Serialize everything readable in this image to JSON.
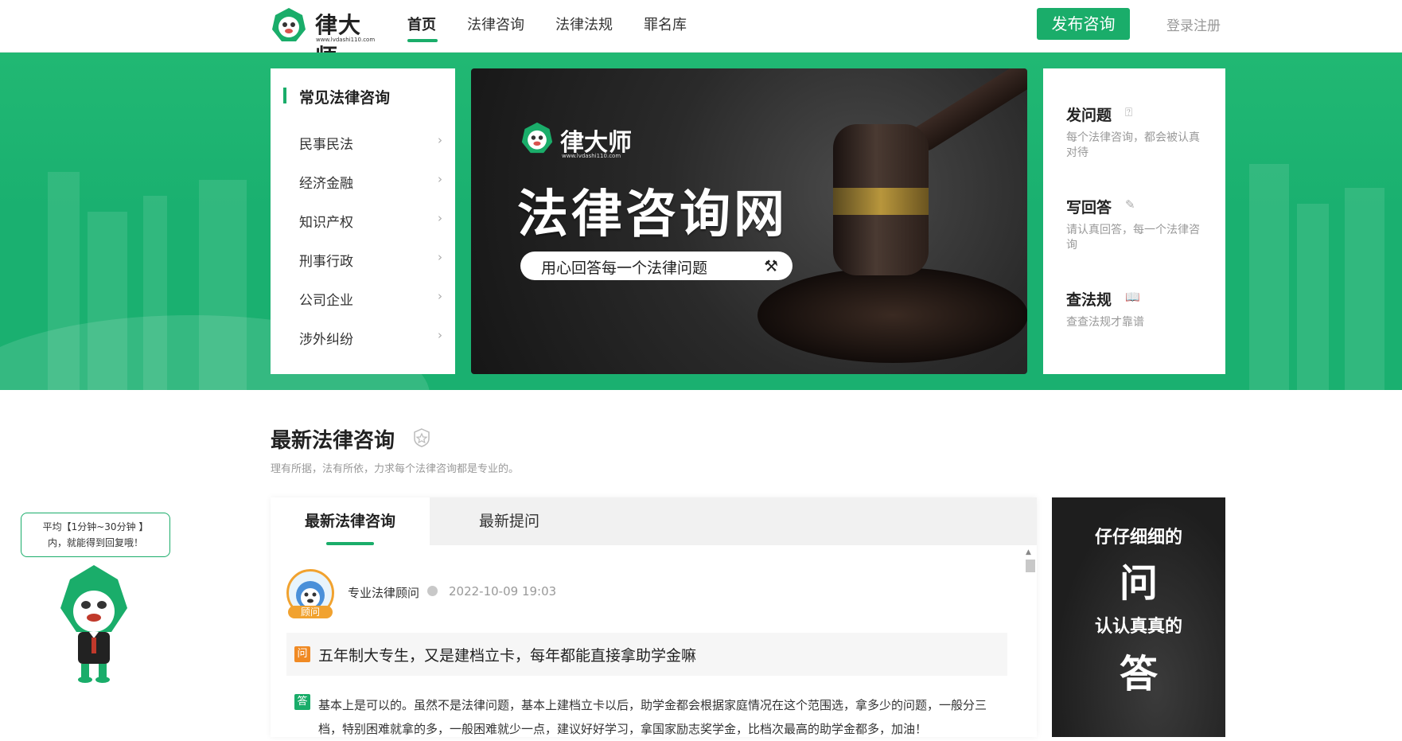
{
  "nav": {
    "logo_text": "律大师",
    "logo_url": "www.lvdashi110.com",
    "links": [
      "首页",
      "法律咨询",
      "法律法规",
      "罪名库"
    ],
    "publish_button": "发布咨询",
    "login": "登录注册"
  },
  "categories": {
    "title": "常见法律咨询",
    "items": [
      "民事民法",
      "经济金融",
      "知识产权",
      "刑事行政",
      "公司企业",
      "涉外纠纷"
    ]
  },
  "banner": {
    "logo_text": "律大师",
    "logo_url": "www.lvdashi110.com",
    "title": "法律咨询网",
    "slogan": "用心回答每一个法律问题"
  },
  "actions": [
    {
      "title": "发问题",
      "desc": "每个法律咨询，都会被认真对待",
      "icon": "question-icon"
    },
    {
      "title": "写回答",
      "desc": "请认真回答，每一个法律咨询",
      "icon": "pencil-icon"
    },
    {
      "title": "查法规",
      "desc": "查查法规才靠谱",
      "icon": "book-icon"
    }
  ],
  "section": {
    "title": "最新法律咨询",
    "subtitle": "理有所据，法有所依，力求每个法律咨询都是专业的。"
  },
  "tabs": [
    "最新法律咨询",
    "最新提问"
  ],
  "post": {
    "author": "专业法律顾问",
    "badge": "顾问",
    "datetime": "2022-10-09 19:03",
    "question_tag": "问",
    "question": "五年制大专生，又是建档立卡，每年都能直接拿助学金嘛",
    "answer_tag": "答",
    "answer": "基本上是可以的。虽然不是法律问题，基本上建档立卡以后，助学金都会根据家庭情况在这个范围选，拿多少的问题，一般分三档，特别困难就拿的多，一般困难就少一点，建议好好学习，拿国家励志奖学金，比档次最高的助学金都多，加油！"
  },
  "side_ad": {
    "line1": "仔仔细细的",
    "line2": "问",
    "line3": "认认真真的",
    "line4": "答"
  },
  "floating_tip": {
    "line1": "平均【1分钟~30分钟 】",
    "line2": "内，就能得到回复哦！"
  },
  "colors": {
    "brand": "#1aad6a",
    "accent": "#f1a22f",
    "question": "#f08a24"
  }
}
